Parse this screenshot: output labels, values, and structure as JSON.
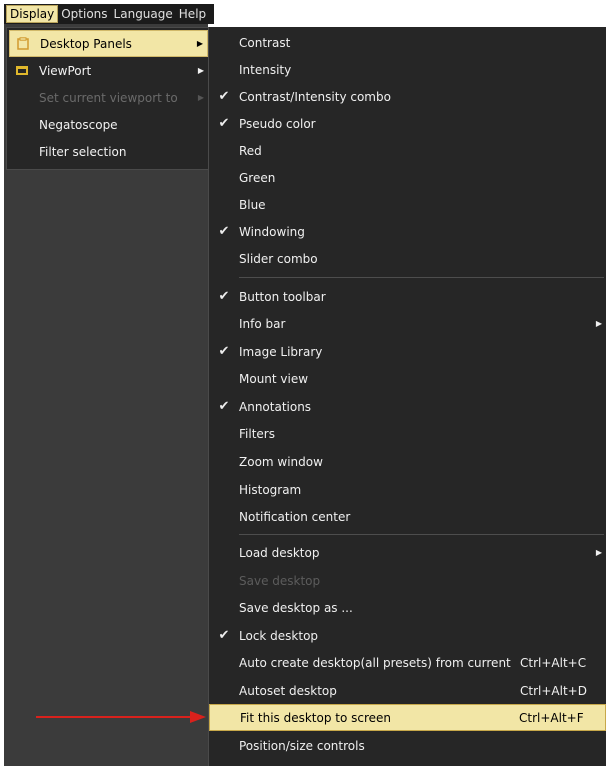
{
  "menubar": {
    "items": [
      {
        "label": "Display",
        "active": true
      },
      {
        "label": "Options",
        "active": false
      },
      {
        "label": "Language",
        "active": false
      },
      {
        "label": "Help",
        "active": false
      }
    ]
  },
  "display_menu": {
    "items": [
      {
        "label": "Desktop Panels",
        "icon": "desktop-panels-icon",
        "submenu": true,
        "highlighted": true,
        "disabled": false
      },
      {
        "label": "ViewPort",
        "icon": "viewport-icon",
        "submenu": true,
        "highlighted": false,
        "disabled": false
      },
      {
        "label": "Set current viewport to",
        "icon": "",
        "submenu": true,
        "highlighted": false,
        "disabled": true
      },
      {
        "label": "Negatoscope",
        "icon": "",
        "submenu": false,
        "highlighted": false,
        "disabled": false
      },
      {
        "label": "Filter selection",
        "icon": "",
        "submenu": false,
        "highlighted": false,
        "disabled": false
      }
    ]
  },
  "panels_menu": {
    "items": [
      {
        "label": "Contrast",
        "checked": false
      },
      {
        "label": "Intensity",
        "checked": false
      },
      {
        "label": "Contrast/Intensity combo",
        "checked": true
      },
      {
        "label": "Pseudo color",
        "checked": true
      },
      {
        "label": "Red",
        "checked": false
      },
      {
        "label": "Green",
        "checked": false
      },
      {
        "label": "Blue",
        "checked": false
      },
      {
        "label": "Windowing",
        "checked": true
      },
      {
        "label": "Slider combo",
        "checked": false
      },
      {
        "separator": true
      },
      {
        "label": "Button toolbar",
        "checked": true
      },
      {
        "label": "Info bar",
        "checked": false,
        "submenu": true
      },
      {
        "label": "Image Library",
        "checked": true
      },
      {
        "label": "Mount view",
        "checked": false
      },
      {
        "label": "Annotations",
        "checked": true
      },
      {
        "label": "Filters",
        "checked": false
      },
      {
        "label": "Zoom window",
        "checked": false
      },
      {
        "label": "Histogram",
        "checked": false
      },
      {
        "label": "Notification center",
        "checked": false
      },
      {
        "separator": true
      },
      {
        "label": "Load desktop",
        "checked": false,
        "submenu": true
      },
      {
        "label": "Save desktop",
        "checked": false,
        "disabled": true
      },
      {
        "label": "Save desktop as ...",
        "checked": false
      },
      {
        "label": "Lock desktop",
        "checked": true
      },
      {
        "label": "Auto create desktop(all presets) from current",
        "checked": false,
        "shortcut": "Ctrl+Alt+C"
      },
      {
        "label": "Autoset desktop",
        "checked": false,
        "shortcut": "Ctrl+Alt+D"
      },
      {
        "label": "Fit this desktop to screen",
        "checked": false,
        "shortcut": "Ctrl+Alt+F",
        "highlighted": true
      },
      {
        "label": "Position/size controls",
        "checked": false
      }
    ]
  },
  "colors": {
    "menu_bg": "#262626",
    "highlight_bg": "#f2e6a6",
    "annotation_arrow": "#d9211c"
  },
  "glyphs": {
    "check": "✔",
    "submenu_arrow": "▶"
  }
}
